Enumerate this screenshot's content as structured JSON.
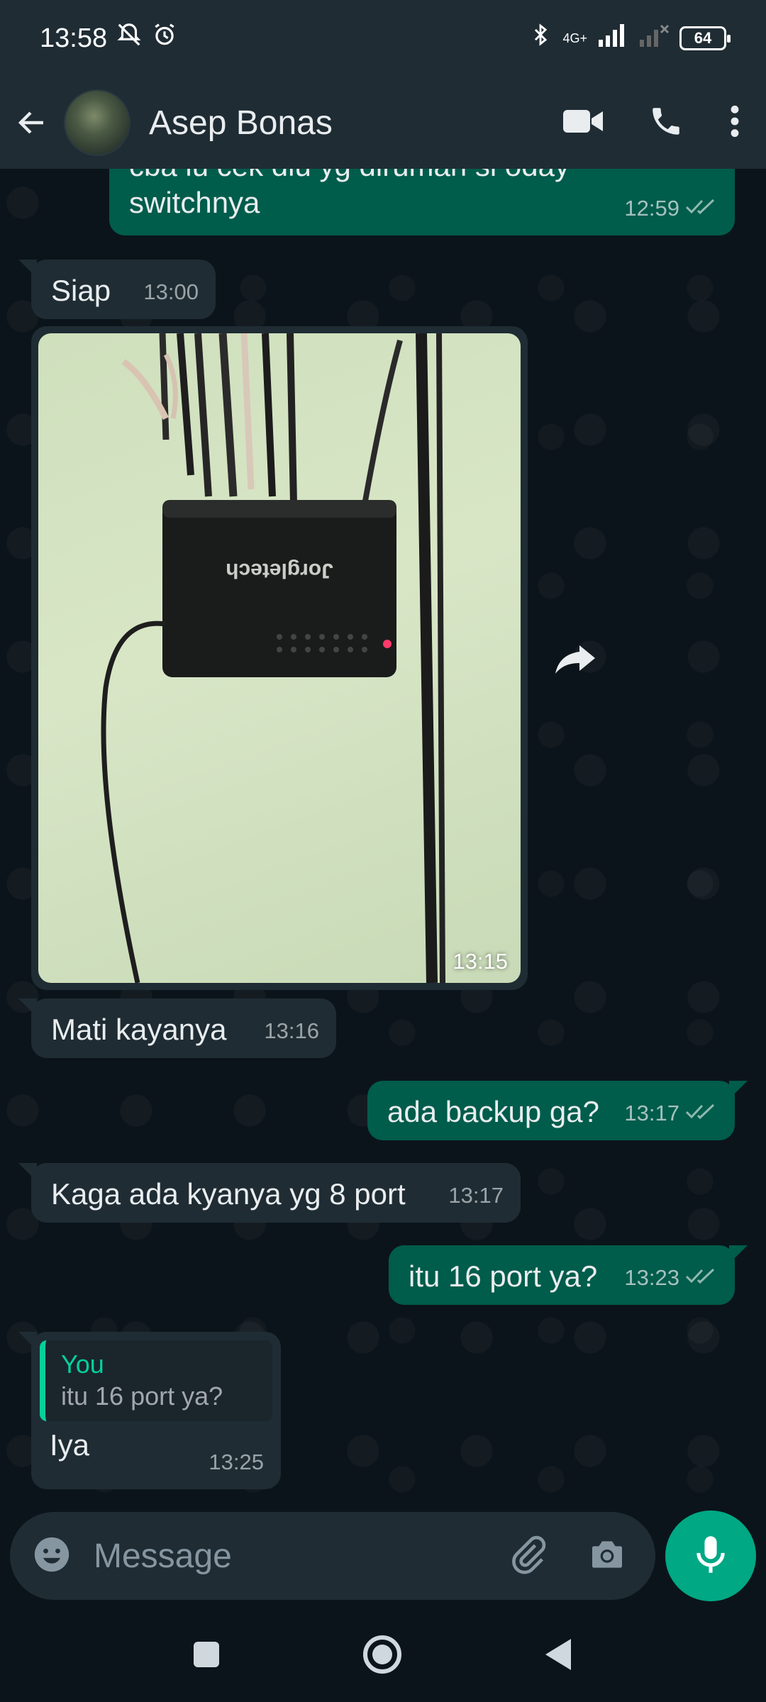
{
  "status": {
    "time": "13:58",
    "network": "4G+",
    "battery": "64"
  },
  "header": {
    "contact_name": "Asep Bonas"
  },
  "messages": [
    {
      "dir": "out",
      "text": "cba lu cek dlu yg dirumah si oday switchnya",
      "time": "12:59"
    },
    {
      "dir": "in",
      "text": "Siap",
      "time": "13:00"
    },
    {
      "dir": "in",
      "type": "image",
      "time": "13:15",
      "image_text": "Jorgletech"
    },
    {
      "dir": "in",
      "text": "Mati kayanya",
      "time": "13:16"
    },
    {
      "dir": "out",
      "text": "ada backup ga?",
      "time": "13:17"
    },
    {
      "dir": "in",
      "text": "Kaga ada kyanya yg 8 port",
      "time": "13:17"
    },
    {
      "dir": "out",
      "text": "itu 16 port ya?",
      "time": "13:23"
    },
    {
      "dir": "in",
      "reply_to": {
        "author": "You",
        "text": "itu 16 port ya?"
      },
      "text": "Iya",
      "time": "13:25"
    }
  ],
  "composer": {
    "placeholder": "Message"
  },
  "colors": {
    "accent": "#00a884",
    "incoming_bubble": "#1f2c34",
    "outgoing_bubble": "#005c4b",
    "background": "#0b141a"
  },
  "icons": [
    "back-arrow-icon",
    "video-call-icon",
    "voice-call-icon",
    "more-options-icon",
    "forward-icon",
    "emoji-icon",
    "attach-icon",
    "camera-icon",
    "mic-icon",
    "nav-recents-icon",
    "nav-home-icon",
    "nav-back-icon"
  ]
}
